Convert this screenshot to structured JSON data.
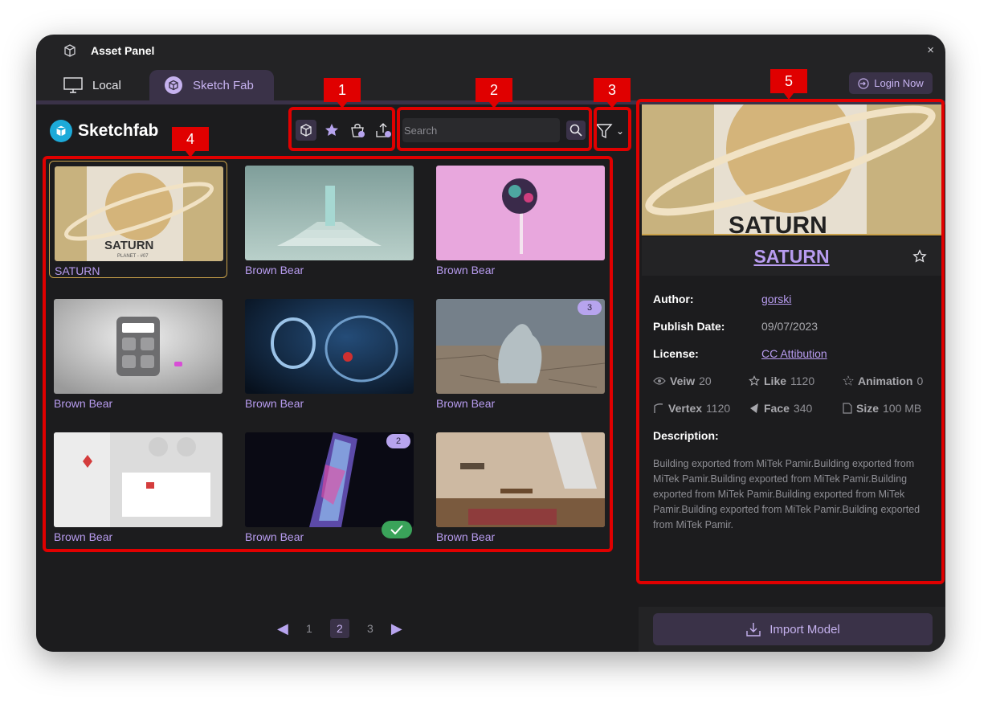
{
  "window": {
    "title": "Asset Panel",
    "close_glyph": "×"
  },
  "tabs": [
    {
      "label": "Local",
      "icon": "monitor-icon"
    },
    {
      "label": "Sketch Fab",
      "icon": "sketchfab-icon"
    }
  ],
  "header": {
    "login_label": "Login Now",
    "login_icon": "login-icon"
  },
  "brand": {
    "name": "Sketchfab",
    "accent": "#1caad9"
  },
  "toolbar": {
    "icons": [
      "cube-icon",
      "star-icon",
      "bag-check-icon",
      "upload-check-icon"
    ]
  },
  "search": {
    "placeholder": "Search",
    "value": ""
  },
  "filter": {
    "icon": "filter-icon",
    "chevron": "⌄"
  },
  "grid": {
    "items": [
      {
        "name": "SATURN",
        "thumb": "saturn",
        "selected": true
      },
      {
        "name": "Brown Bear",
        "thumb": "stairs"
      },
      {
        "name": "Brown Bear",
        "thumb": "lollipop"
      },
      {
        "name": "Brown Bear",
        "thumb": "calculator"
      },
      {
        "name": "Brown Bear",
        "thumb": "glass"
      },
      {
        "name": "Brown Bear",
        "thumb": "sculpture",
        "badge": "3"
      },
      {
        "name": "Brown Bear",
        "thumb": "interior"
      },
      {
        "name": "Brown Bear",
        "thumb": "crystal",
        "badge": "2",
        "checked": true
      },
      {
        "name": "Brown Bear",
        "thumb": "room"
      }
    ],
    "saturn_thumb_title": "SATURN",
    "saturn_thumb_sub": "PLANET - #07"
  },
  "pagination": {
    "pages": [
      "1",
      "2",
      "3"
    ],
    "current": "2",
    "prev_glyph": "◀",
    "next_glyph": "▶"
  },
  "detail": {
    "preview_text": "SATURN",
    "title": "SATURN",
    "author_label": "Author:",
    "author": "gorski",
    "publish_label": "Publish Date:",
    "publish_date": "09/07/2023",
    "license_label": "License:",
    "license": "CC Attibution",
    "view_label": "Veiw",
    "view": "20",
    "like_label": "Like",
    "like": "1120",
    "animation_label": "Animation",
    "animation": "0",
    "vertex_label": "Vertex",
    "vertex": "1120",
    "face_label": "Face",
    "face": "340",
    "size_label": "Size",
    "size": "100 MB",
    "description_label": "Description:",
    "description": "Building exported from MiTek Pamir.Building exported from MiTek Pamir.Building exported from MiTek Pamir.Building exported from MiTek Pamir.Building exported from MiTek Pamir.Building exported from MiTek Pamir.Building exported from MiTek Pamir."
  },
  "import": {
    "label": "Import Model",
    "icon": "download-icon"
  },
  "callouts": [
    "1",
    "2",
    "3",
    "4",
    "5"
  ],
  "colors": {
    "accent": "#b89cf0",
    "panel": "#1c1c1e",
    "tab_active": "#3a3248",
    "callout": "#e00000",
    "selected_border": "#c9a14a"
  }
}
